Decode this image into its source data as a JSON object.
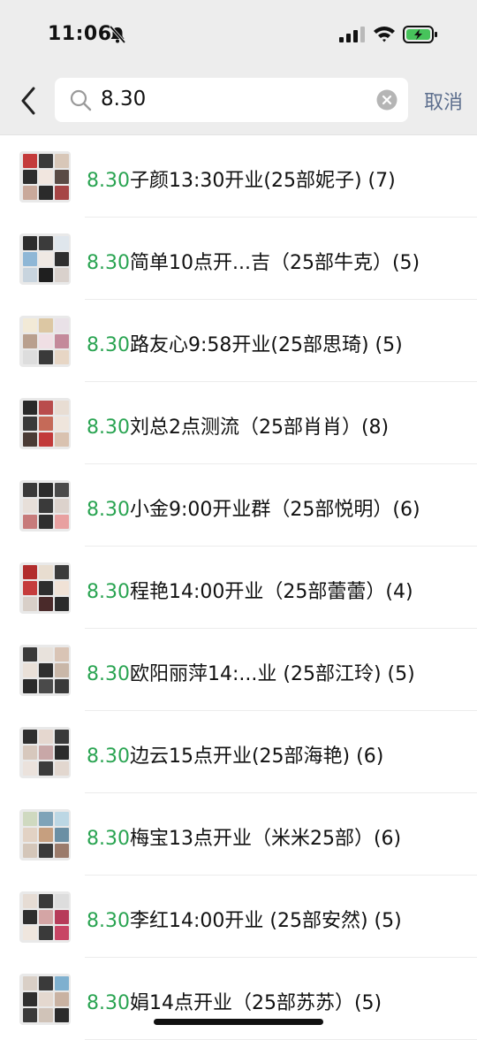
{
  "status_bar": {
    "time": "11:06"
  },
  "search": {
    "query": "8.30",
    "cancel_label": "取消"
  },
  "colors": {
    "highlight": "#2aa452",
    "cancel": "#5d6f8e",
    "header_bg": "#ededed"
  },
  "results": [
    {
      "highlight": "8.30",
      "rest": "子颜13:30开业(25部妮子) (7)"
    },
    {
      "highlight": "8.30",
      "rest": "简单10点开...吉（25部牛克）(5)"
    },
    {
      "highlight": "8.30",
      "rest": "路友心9:58开业(25部思琦) (5)"
    },
    {
      "highlight": "8.30",
      "rest": "刘总2点测流（25部肖肖）(8)"
    },
    {
      "highlight": "8.30",
      "rest": "小金9:00开业群（25部悦明）(6)"
    },
    {
      "highlight": "8.30",
      "rest": "程艳14:00开业（25部蕾蕾）(4)"
    },
    {
      "highlight": "8.30",
      "rest": "欧阳丽萍14:...业 (25部江玲) (5)"
    },
    {
      "highlight": "8.30",
      "rest": "边云15点开业(25部海艳) (6)"
    },
    {
      "highlight": "8.30",
      "rest": "梅宝13点开业（米米25部）(6)"
    },
    {
      "highlight": "8.30",
      "rest": "李红14:00开业 (25部安然) (5)"
    },
    {
      "highlight": "8.30",
      "rest": "娟14点开业（25部苏苏）(5)"
    }
  ]
}
